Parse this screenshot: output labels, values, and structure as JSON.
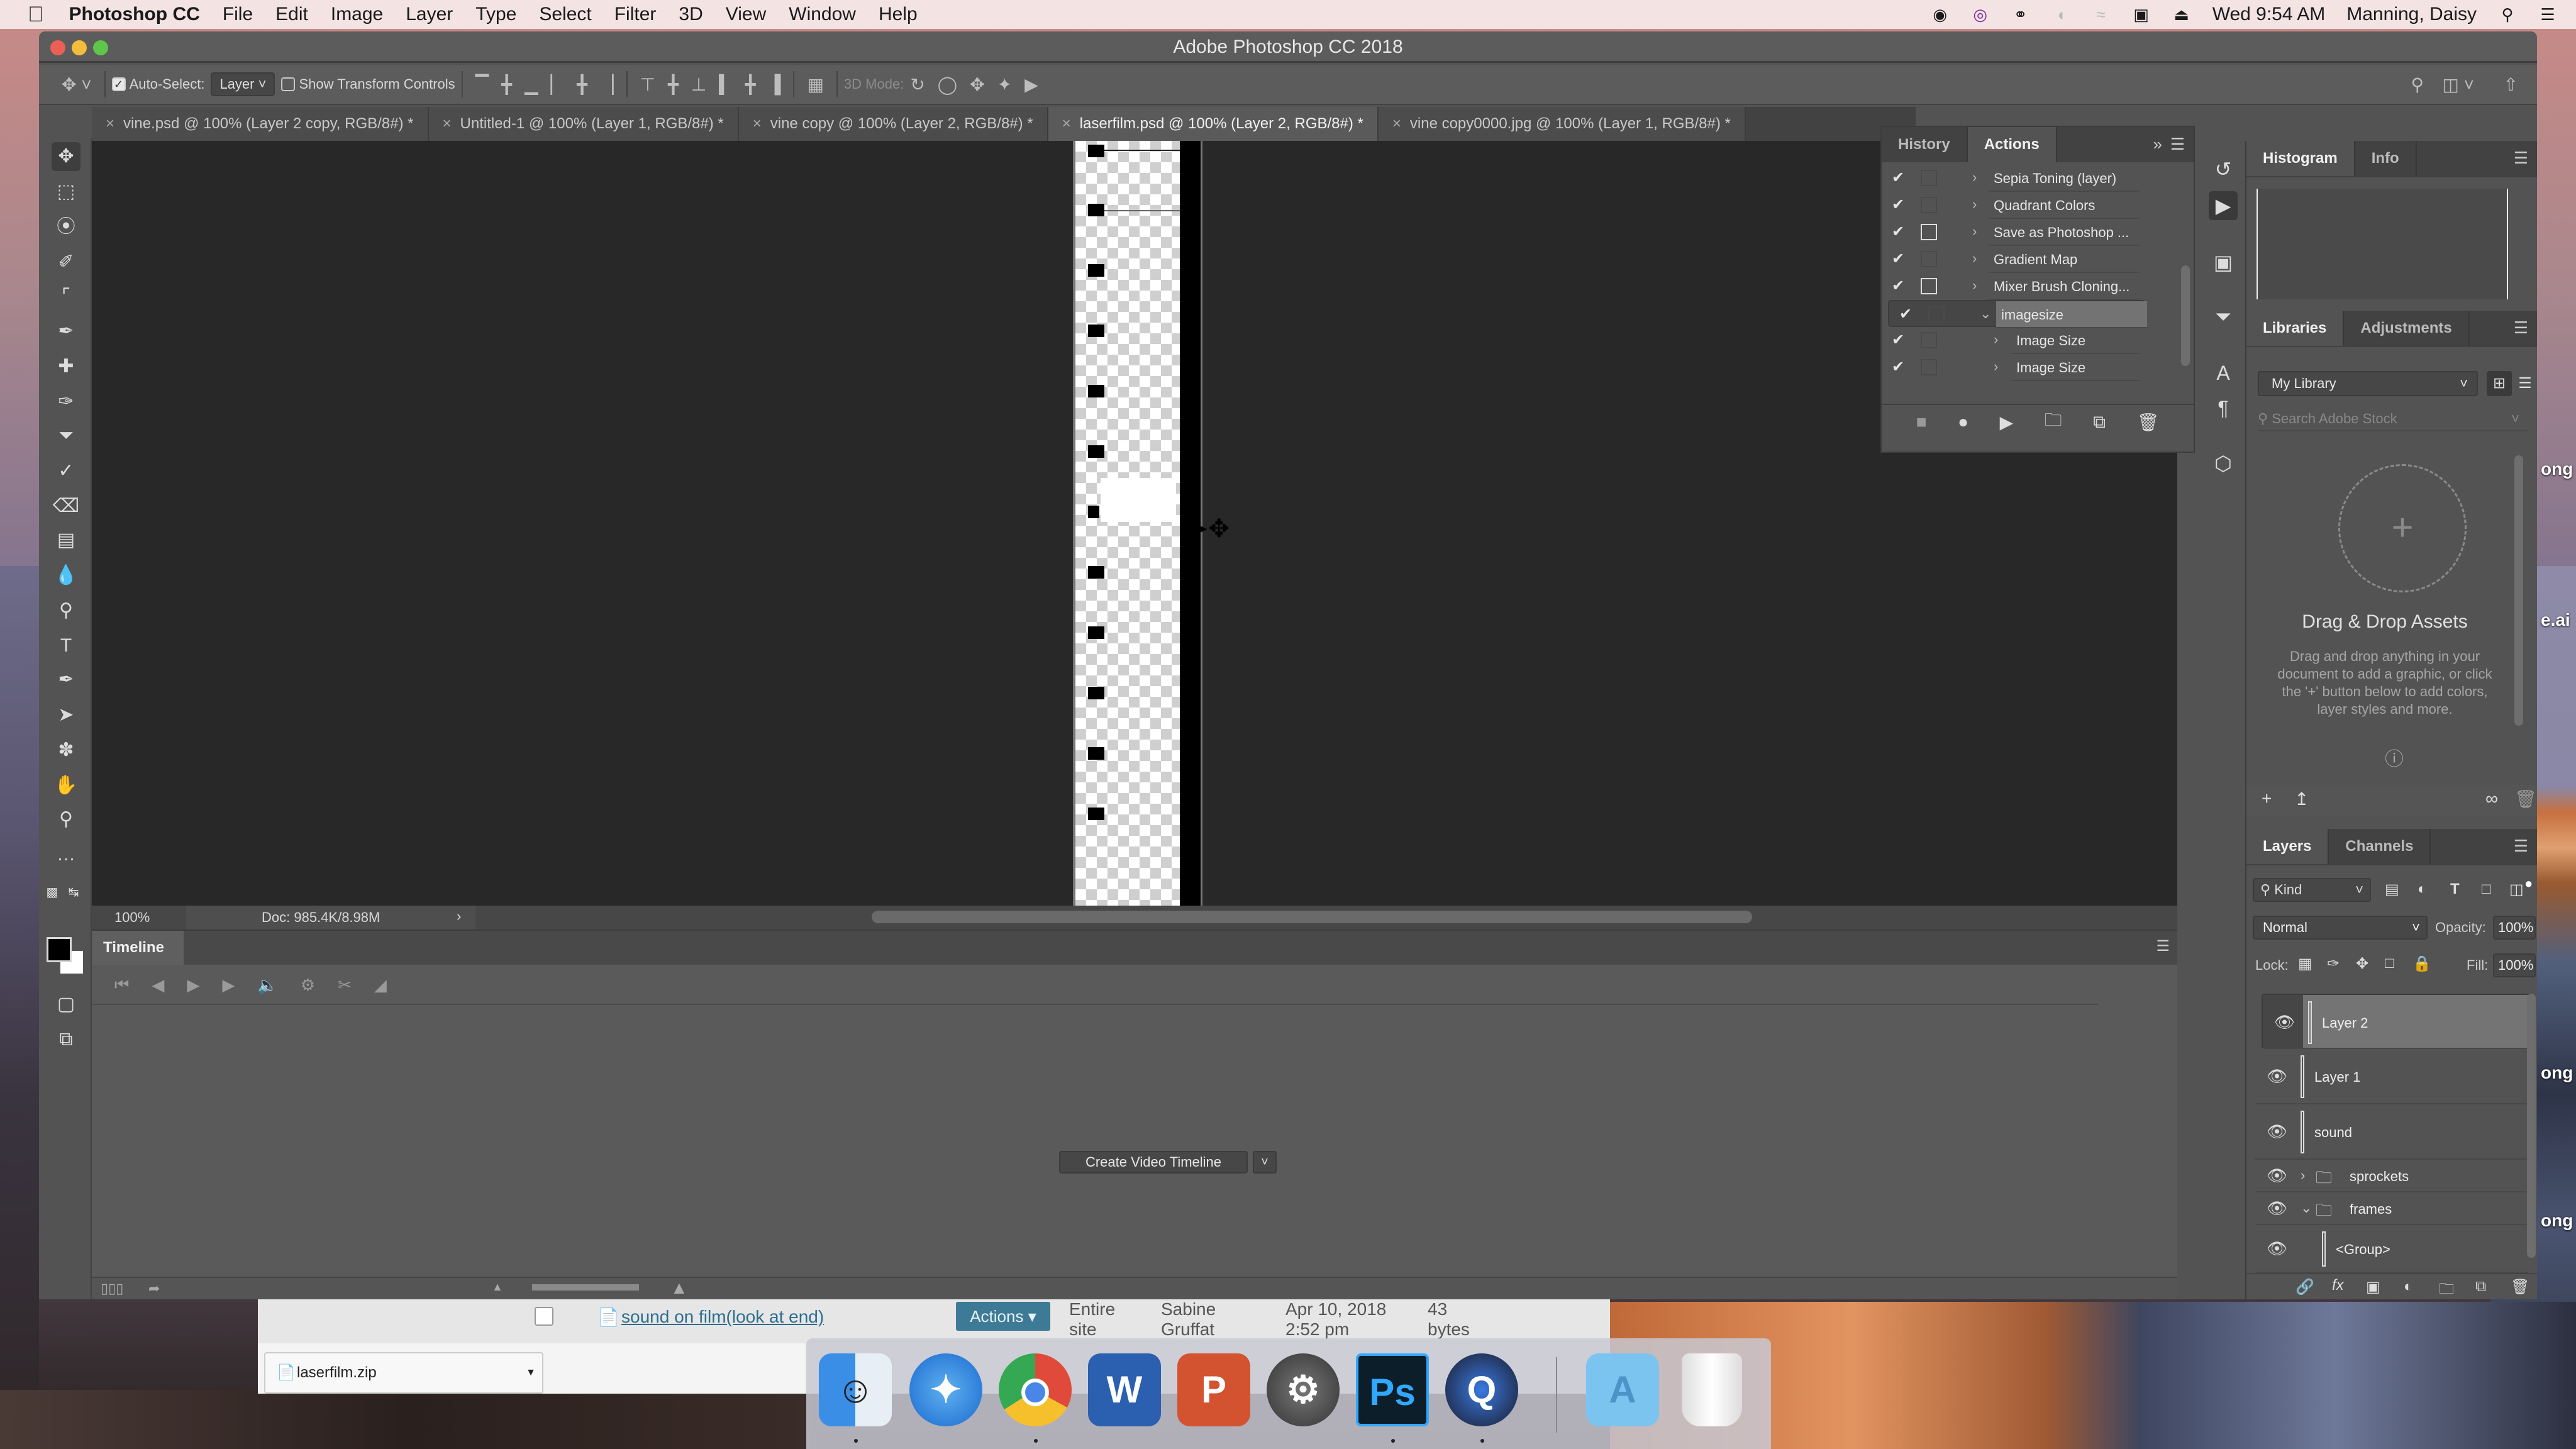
{
  "menubar": {
    "app_name": "Photoshop CC",
    "items": [
      "File",
      "Edit",
      "Image",
      "Layer",
      "Type",
      "Select",
      "Filter",
      "3D",
      "View",
      "Window",
      "Help"
    ],
    "clock": "Wed 9:54 AM",
    "user": "Manning, Daisy"
  },
  "window": {
    "title": "Adobe Photoshop CC 2018"
  },
  "options": {
    "auto_select_label": "Auto-Select:",
    "auto_select_checked": true,
    "auto_select_target": "Layer",
    "show_transform_label": "Show Transform Controls",
    "show_transform_checked": false,
    "mode_3d_label": "3D Mode:"
  },
  "doc_tabs": [
    {
      "label": "vine.psd @ 100% (Layer 2 copy, RGB/8#) *",
      "active": false
    },
    {
      "label": "Untitled-1 @ 100% (Layer 1, RGB/8#) *",
      "active": false
    },
    {
      "label": "vine copy @ 100% (Layer 2, RGB/8#) *",
      "active": false
    },
    {
      "label": "laserfilm.psd @ 100% (Layer 2, RGB/8#) *",
      "active": true
    },
    {
      "label": "vine copy0000.jpg @ 100% (Layer 1, RGB/8#) *",
      "active": false
    }
  ],
  "status": {
    "zoom": "100%",
    "doc_size": "Doc: 985.4K/8.98M"
  },
  "timeline": {
    "tab": "Timeline",
    "create_button": "Create Video Timeline"
  },
  "actions_panel": {
    "tabs": [
      "History",
      "Actions"
    ],
    "active_tab": "Actions",
    "items": [
      {
        "label": "Sepia Toning (layer)",
        "checked": true,
        "dialog": false,
        "expanded": false,
        "level": 0
      },
      {
        "label": "Quadrant Colors",
        "checked": true,
        "dialog": false,
        "expanded": false,
        "level": 0
      },
      {
        "label": "Save as Photoshop ...",
        "checked": true,
        "dialog": true,
        "expanded": false,
        "level": 0
      },
      {
        "label": "Gradient Map",
        "checked": true,
        "dialog": false,
        "expanded": false,
        "level": 0
      },
      {
        "label": "Mixer Brush Cloning...",
        "checked": true,
        "dialog": true,
        "expanded": false,
        "level": 0
      },
      {
        "label": "imagesize",
        "checked": true,
        "dialog": false,
        "expanded": true,
        "level": 0,
        "selected": true
      },
      {
        "label": "Image Size",
        "checked": true,
        "dialog": false,
        "expanded": false,
        "level": 1
      },
      {
        "label": "Image Size",
        "checked": true,
        "dialog": false,
        "expanded": false,
        "level": 1
      }
    ]
  },
  "histogram_panel": {
    "tabs": [
      "Histogram",
      "Info"
    ],
    "active_tab": "Histogram"
  },
  "libraries_panel": {
    "tabs": [
      "Libraries",
      "Adjustments"
    ],
    "active_tab": "Libraries",
    "library": "My Library",
    "search_placeholder": "Search Adobe Stock",
    "empty_title": "Drag & Drop Assets",
    "empty_body": "Drag and drop anything in your document to add a graphic, or click the '+' button below to add colors, layer styles and more."
  },
  "layers_panel": {
    "tabs": [
      "Layers",
      "Channels"
    ],
    "active_tab": "Layers",
    "filter": "Kind",
    "blend_mode": "Normal",
    "opacity_label": "Opacity:",
    "opacity": "100%",
    "lock_label": "Lock:",
    "fill_label": "Fill:",
    "fill": "100%",
    "layers": [
      {
        "name": "Layer 2",
        "type": "layer",
        "visible": true,
        "selected": true
      },
      {
        "name": "Layer 1",
        "type": "layer",
        "visible": true,
        "selected": false
      },
      {
        "name": "sound",
        "type": "layer",
        "visible": true,
        "selected": false
      },
      {
        "name": "sprockets",
        "type": "group",
        "visible": true,
        "expanded": false
      },
      {
        "name": "frames",
        "type": "group",
        "visible": true,
        "expanded": true
      },
      {
        "name": "<Group>",
        "type": "layer",
        "visible": true,
        "indent": 1
      }
    ]
  },
  "browser": {
    "file_link": "sound on film(look at end)",
    "actions_button": "Actions ▾",
    "col_location": "Entire site",
    "col_author": "Sabine Gruffat",
    "col_date": "Apr 10, 2018 2:52 pm",
    "col_size": "43 bytes",
    "download_file": "laserfilm.zip"
  },
  "desktop": {
    "labels": [
      "ong",
      "e.ai",
      "ong",
      "ong"
    ]
  },
  "dock": [
    "Finder",
    "Safari",
    "Chrome",
    "Word",
    "PowerPoint",
    "System Preferences",
    "Photoshop",
    "QuickTime",
    "Applications",
    "Trash"
  ]
}
